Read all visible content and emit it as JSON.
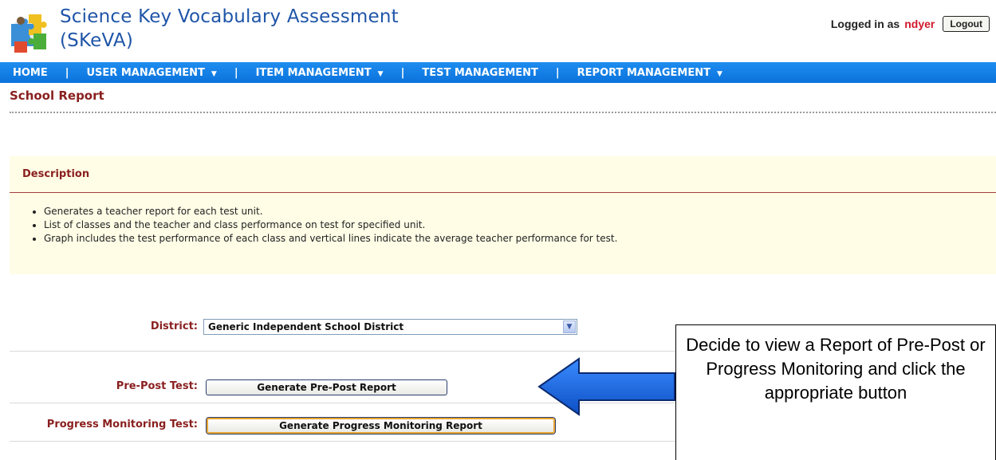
{
  "header": {
    "title_line1": "Science Key Vocabulary Assessment",
    "title_line2": "(SKeVA)",
    "logged_in_label": "Logged in as",
    "username": "ndyer",
    "logout_label": "Logout"
  },
  "nav": {
    "home": "HOME",
    "user_management": "USER MANAGEMENT",
    "item_management": "ITEM MANAGEMENT",
    "test_management": "TEST MANAGEMENT",
    "report_management": "REPORT MANAGEMENT",
    "separator": "|"
  },
  "page": {
    "title": "School Report"
  },
  "description": {
    "heading": "Description",
    "items": [
      "Generates a teacher report for each test unit.",
      "List of classes and the teacher and class performance on test for specified unit.",
      "Graph includes the test performance of each class and vertical lines indicate the average teacher performance for test."
    ]
  },
  "form": {
    "district_label": "District:",
    "district_value": "Generic Independent School District",
    "prepost_label": "Pre-Post Test:",
    "prepost_button": "Generate Pre-Post Report",
    "progress_label": "Progress Monitoring Test:",
    "progress_button": "Generate Progress Monitoring Report"
  },
  "callout": {
    "text": "Decide to view a  Report of Pre-Post or Progress Monitoring and click the appropriate button"
  },
  "colors": {
    "nav_blue": "#0a73dc",
    "title_maroon": "#8a1f1f",
    "desc_background": "#fffde6",
    "username_red": "#d0182b",
    "arrow_blue": "#1560e0"
  }
}
